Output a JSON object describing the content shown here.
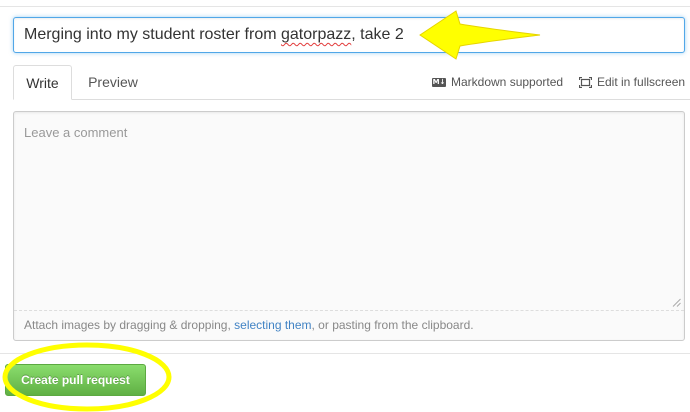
{
  "title_input": {
    "value_before": "Merging into my student roster from ",
    "value_misspelled": "gatorpazz",
    "value_after": ", take 2"
  },
  "tabs": [
    {
      "label": "Write",
      "active": true
    },
    {
      "label": "Preview",
      "active": false
    }
  ],
  "toolbar": {
    "markdown_icon": "markdown-icon",
    "markdown_label": "Markdown supported",
    "fullscreen_icon": "fullscreen-icon",
    "fullscreen_label": "Edit in fullscreen"
  },
  "comment": {
    "placeholder": "Leave a comment",
    "attach_before": "Attach images by dragging & dropping, ",
    "attach_link": "selecting them",
    "attach_after": ", or pasting from the clipboard."
  },
  "actions": {
    "create_label": "Create pull request"
  },
  "annotations": {
    "color": "#ffff00"
  }
}
